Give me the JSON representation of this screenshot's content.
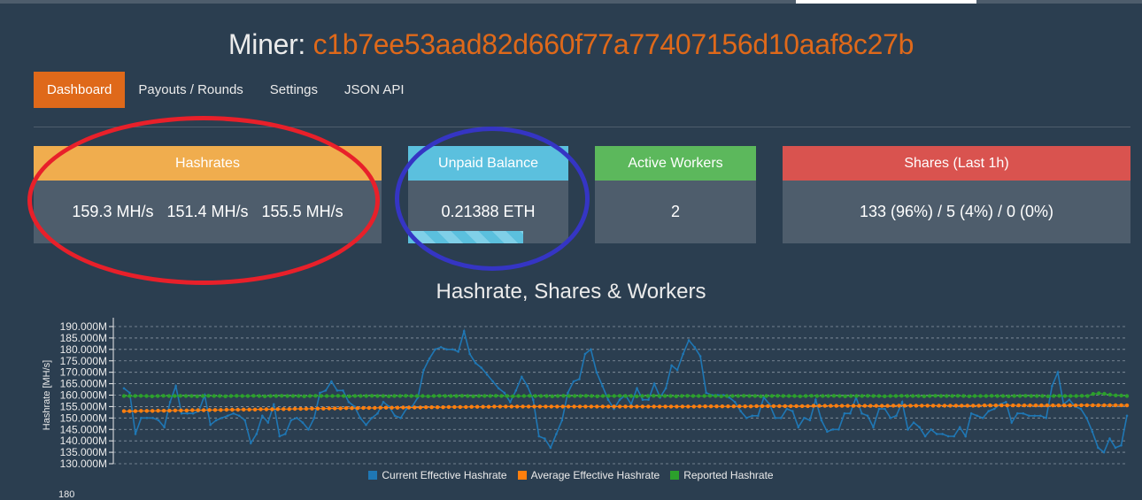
{
  "header": {
    "miner_label": "Miner:",
    "address": "c1b7ee53aad82d660f77a77407156d10aaf8c27b"
  },
  "nav": {
    "items": [
      "Dashboard",
      "Payouts / Rounds",
      "Settings",
      "JSON API"
    ],
    "active": "Dashboard"
  },
  "panels": {
    "hashrates": {
      "title": "Hashrates",
      "values": [
        "159.3 MH/s",
        "151.4 MH/s",
        "155.5 MH/s"
      ]
    },
    "balance": {
      "title": "Unpaid Balance",
      "value": "0.21388 ETH",
      "progress": 0.72
    },
    "workers": {
      "title": "Active Workers",
      "value": "2"
    },
    "shares": {
      "title": "Shares (Last 1h)",
      "value": "133 (96%) / 5 (4%) / 0 (0%)"
    }
  },
  "colors": {
    "accent": "#df691a",
    "hashrates": "#f0ad4e",
    "balance": "#5bc0de",
    "workers": "#5cb85c",
    "shares": "#d9534f",
    "annotation_red": "#e8202a",
    "annotation_blue": "#3535c4"
  },
  "chart_data": {
    "type": "line",
    "title": "Hashrate, Shares & Workers",
    "ylabel": "Hashrate [MH/s]",
    "ylim": [
      130,
      190
    ],
    "yticks": [
      "130.000M",
      "135.000M",
      "140.000M",
      "145.000M",
      "150.000M",
      "155.000M",
      "160.000M",
      "165.000M",
      "170.000M",
      "175.000M",
      "180.000M",
      "185.000M",
      "190.000M"
    ],
    "grid": true,
    "legend_position": "bottom",
    "series": [
      {
        "name": "Current Effective Hashrate",
        "color": "#1f77b4",
        "values": [
          163,
          161,
          143,
          150,
          150,
          150,
          149,
          146,
          157,
          164,
          152,
          152,
          152,
          153,
          160,
          147,
          149,
          150,
          151,
          152,
          151,
          149,
          139,
          143,
          151,
          148,
          156,
          142,
          143,
          149,
          150,
          148,
          145,
          150,
          161,
          162,
          166,
          162,
          162,
          157,
          155,
          150,
          147,
          150,
          152,
          157,
          155,
          151,
          150,
          154,
          155,
          159,
          171,
          176,
          180,
          181,
          180,
          180,
          179,
          188,
          178,
          174,
          172,
          169,
          166,
          163,
          161,
          157,
          162,
          168,
          164,
          158,
          142,
          141,
          137,
          143,
          149,
          161,
          166,
          167,
          178,
          180,
          170,
          164,
          158,
          154,
          158,
          160,
          156,
          163,
          158,
          158,
          165,
          159,
          163,
          173,
          171,
          178,
          184,
          181,
          177,
          161,
          160,
          160,
          160,
          159,
          157,
          153,
          150,
          151,
          151,
          159,
          156,
          150,
          150,
          154,
          153,
          146,
          150,
          149,
          158,
          149,
          144,
          145,
          145,
          152,
          152,
          159,
          152,
          151,
          146,
          154,
          154,
          150,
          151,
          157,
          145,
          148,
          146,
          142,
          145,
          143,
          143,
          142,
          142,
          146,
          142,
          152,
          151,
          150,
          153,
          154,
          156,
          157,
          148,
          152,
          152,
          151,
          151,
          151,
          150,
          164,
          170,
          156,
          158,
          155,
          154,
          150,
          144,
          137,
          135,
          141,
          137,
          138,
          151
        ]
      },
      {
        "name": "Average Effective Hashrate",
        "color": "#ff7f0e",
        "values": [
          153.0,
          153.0,
          153.0,
          153.1,
          153.1,
          153.1,
          153.2,
          153.2,
          153.2,
          153.3,
          153.3,
          153.3,
          153.4,
          153.4,
          153.4,
          153.5,
          153.5,
          153.5,
          153.6,
          153.6,
          153.6,
          153.7,
          153.7,
          153.7,
          153.8,
          153.8,
          153.8,
          153.9,
          153.9,
          153.9,
          154.0,
          154.0,
          154.0,
          154.1,
          154.1,
          154.1,
          154.2,
          154.2,
          154.2,
          154.3,
          154.3,
          154.3,
          154.4,
          154.4,
          154.4,
          154.5,
          154.5,
          154.5,
          154.5,
          154.6,
          154.6,
          154.6,
          154.6,
          154.7,
          154.7,
          154.7,
          154.7,
          154.8,
          154.8,
          154.8,
          154.8,
          154.9,
          154.9,
          154.9,
          154.9,
          155.0,
          155.0,
          155.0,
          155.0,
          155.0,
          155.0,
          155.0,
          155.0,
          155.0,
          155.0,
          155.0,
          155.0,
          155.0,
          155.0,
          155.0,
          155.0,
          155.0,
          155.0,
          155.0,
          155.0,
          155.0,
          155.0,
          155.0,
          155.0,
          155.0,
          155.0,
          155.0,
          155.0,
          155.0,
          155.0,
          155.0,
          155.0,
          155.0,
          155.0,
          155.0,
          155.0,
          155.1,
          155.1,
          155.1,
          155.1,
          155.1,
          155.1,
          155.1,
          155.1,
          155.1,
          155.1,
          155.2,
          155.2,
          155.2,
          155.2,
          155.2,
          155.2,
          155.2,
          155.2,
          155.2,
          155.2,
          155.3,
          155.3,
          155.3,
          155.3,
          155.3,
          155.3,
          155.3,
          155.3,
          155.3,
          155.3,
          155.3,
          155.3,
          155.3,
          155.3,
          155.4,
          155.4,
          155.4,
          155.4,
          155.4,
          155.4,
          155.4,
          155.4,
          155.4,
          155.4,
          155.4,
          155.4,
          155.4,
          155.4,
          155.4,
          155.4,
          155.5,
          155.5,
          155.5,
          155.5,
          155.5,
          155.5,
          155.5,
          155.5,
          155.5,
          155.5,
          155.5,
          155.5,
          155.5,
          155.5,
          155.5,
          155.5,
          155.5,
          155.6,
          155.6,
          155.6,
          155.6,
          155.6,
          155.6,
          155.6,
          155.6,
          155.5
        ]
      },
      {
        "name": "Reported Hashrate",
        "color": "#2ca02c",
        "values": [
          159.6,
          159.6,
          159.6,
          159.7,
          159.6,
          159.5,
          159.6,
          159.7,
          159.6,
          159.6,
          159.7,
          159.6,
          159.6,
          159.5,
          159.6,
          159.7,
          159.6,
          159.6,
          159.5,
          159.6,
          159.7,
          159.6,
          159.6,
          159.7,
          159.6,
          159.5,
          159.6,
          159.6,
          159.7,
          159.6,
          159.6,
          159.6,
          159.5,
          159.6,
          159.7,
          159.6,
          159.6,
          159.6,
          159.7,
          159.6,
          159.5,
          159.6,
          159.6,
          159.6,
          159.7,
          159.6,
          159.6,
          159.5,
          159.6,
          159.6,
          159.7,
          159.6,
          159.6,
          159.6,
          159.5,
          159.6,
          159.7,
          159.6,
          159.6,
          159.6,
          159.7,
          159.6,
          159.5,
          159.6,
          159.6,
          159.6,
          159.7,
          159.6,
          159.6,
          159.5,
          159.6,
          159.6,
          159.7,
          159.6,
          159.6,
          159.6,
          159.5,
          159.6,
          159.7,
          159.6,
          159.6,
          159.6,
          159.7,
          159.6,
          159.5,
          159.6,
          159.6,
          159.6,
          159.7,
          159.6,
          159.6,
          159.5,
          159.6,
          159.6,
          159.7,
          159.6,
          159.6,
          159.6,
          159.5,
          159.6,
          159.7,
          159.6,
          159.6,
          159.6,
          159.7,
          159.6,
          159.5,
          159.6,
          159.6,
          159.6,
          159.7,
          159.6,
          159.6,
          159.5,
          159.6,
          159.6,
          159.7,
          159.6,
          159.6,
          159.6,
          159.5,
          159.6,
          159.7,
          159.6,
          159.6,
          159.6,
          159.7,
          159.6,
          159.5,
          159.6,
          159.6,
          159.6,
          159.7,
          159.6,
          159.6,
          159.5,
          159.6,
          159.6,
          159.7,
          159.6,
          159.6,
          159.6,
          159.5,
          159.6,
          159.7,
          159.6,
          159.6,
          159.6,
          159.7,
          159.6,
          159.5,
          159.6,
          159.6,
          159.6,
          159.7,
          159.6,
          159.6,
          159.5,
          159.6,
          159.6,
          159.7,
          159.6,
          159.6,
          159.6,
          159.5,
          159.6,
          159.7,
          159.6,
          159.6,
          159.6,
          159.7,
          159.6,
          160.5,
          160.8,
          160.6,
          160.2,
          159.9,
          159.8,
          159.6
        ]
      }
    ],
    "second_chart_first_tick": "180"
  }
}
